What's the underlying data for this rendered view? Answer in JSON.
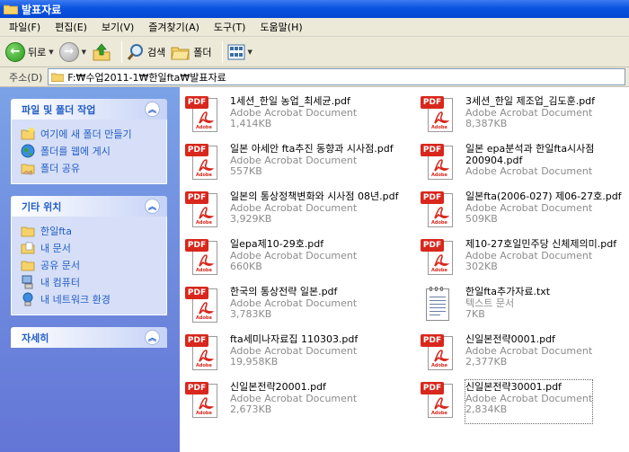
{
  "window": {
    "title": "발표자료"
  },
  "menu": [
    "파일(F)",
    "편집(E)",
    "보기(V)",
    "즐겨찾기(A)",
    "도구(T)",
    "도움말(H)"
  ],
  "toolbar": {
    "back": "뒤로",
    "search": "검색",
    "folders": "폴더"
  },
  "address": {
    "label": "주소(D)",
    "path": "F:₩수업2011-1₩한일fta₩발표자료"
  },
  "left_pane": {
    "file_tasks": {
      "title": "파일 및 폴더 작업",
      "items": [
        "여기에 새 폴더 만들기",
        "폴더를 웹에 게시",
        "폴더 공유"
      ]
    },
    "other_places": {
      "title": "기타 위치",
      "items": [
        "한일fta",
        "내 문서",
        "공유 문서",
        "내 컴퓨터",
        "내 네트워크 환경"
      ]
    },
    "details": {
      "title": "자세히"
    }
  },
  "files": [
    {
      "name": "1세션_한일 농업_최세균.pdf",
      "type": "Adobe Acrobat Document",
      "size": "1,414KB",
      "kind": "pdf"
    },
    {
      "name": "3세션_한일 제조업_김도훈.pdf",
      "type": "Adobe Acrobat Document",
      "size": "8,387KB",
      "kind": "pdf"
    },
    {
      "name": "일본 아세안 fta추진 동향과 시사점.pdf",
      "type": "Adobe Acrobat Document",
      "size": "557KB",
      "kind": "pdf"
    },
    {
      "name": "일본 epa분석과 한일fta시사점",
      "name2": "200904.pdf",
      "type": "Adobe Acrobat Document",
      "size": "",
      "kind": "pdf"
    },
    {
      "name": "일본의 통상정책변화와 시사점 08년.pdf",
      "type": "Adobe Acrobat Document",
      "size": "3,929KB",
      "kind": "pdf"
    },
    {
      "name": "일본fta(2006-027) 제06-27호.pdf",
      "type": "Adobe Acrobat Document",
      "size": "509KB",
      "kind": "pdf"
    },
    {
      "name": "일epa제10-29호.pdf",
      "type": "Adobe Acrobat Document",
      "size": "660KB",
      "kind": "pdf"
    },
    {
      "name": "제10-27호일민주당 신체제의미.pdf",
      "type": "Adobe Acrobat Document",
      "size": "302KB",
      "kind": "pdf"
    },
    {
      "name": "한국의 통상전략 일본.pdf",
      "type": "Adobe Acrobat Document",
      "size": "3,783KB",
      "kind": "pdf"
    },
    {
      "name": "한일fta추가자료.txt",
      "type": "텍스트 문서",
      "size": "7KB",
      "kind": "txt"
    },
    {
      "name": "fta세미나자료집 110303.pdf",
      "type": "Adobe Acrobat Document",
      "size": "19,958KB",
      "kind": "pdf"
    },
    {
      "name": "신일본전략0001.pdf",
      "type": "Adobe Acrobat Document",
      "size": "2,377KB",
      "kind": "pdf"
    },
    {
      "name": "신일본전략20001.pdf",
      "type": "Adobe Acrobat Document",
      "size": "2,673KB",
      "kind": "pdf"
    },
    {
      "name": "신일본전략30001.pdf",
      "type": "Adobe Acrobat Document",
      "size": "2,834KB",
      "kind": "pdf",
      "selected": true
    }
  ],
  "colors": {
    "title_bar": "#0a54e0",
    "task_pane": "#6f8de0",
    "pdf_red": "#d8271c",
    "link_blue": "#215dc6"
  }
}
